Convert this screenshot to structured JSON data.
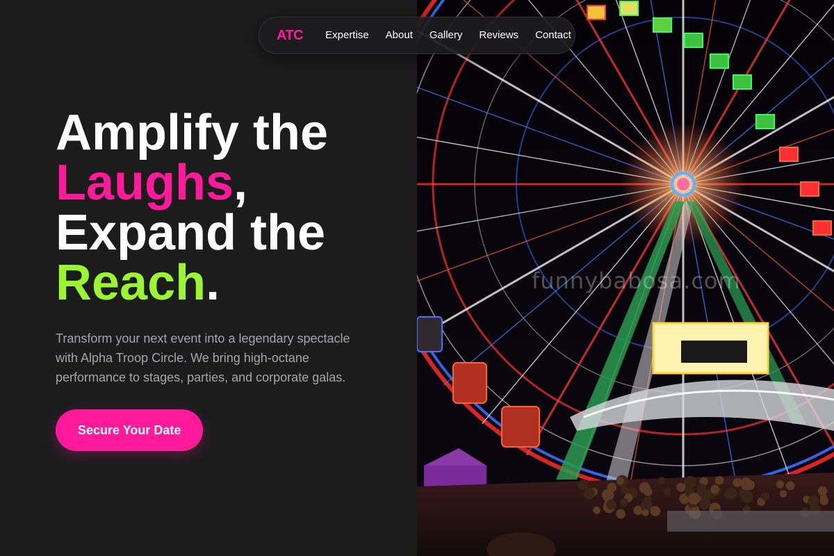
{
  "nav": {
    "logo": "ATC",
    "links": [
      "Expertise",
      "About",
      "Gallery",
      "Reviews",
      "Contact"
    ]
  },
  "hero": {
    "line1": "Amplify the",
    "line2_highlight": "Laughs",
    "line2_punct": ",",
    "line3": "Expand the",
    "line4_highlight": "Reach",
    "line4_punct": ".",
    "description": "Transform your next event into a legendary spectacle with Alpha Troop Circle. We bring high-octane performance to stages, parties, and corporate galas.",
    "cta_label": "Secure Your Date"
  },
  "image": {
    "watermark": "funnybabosa.com"
  },
  "colors": {
    "background": "#1c1c1d",
    "accent_pink": "#ff1a9c",
    "accent_green": "#9cf531",
    "text_primary": "#ffffff",
    "text_muted": "#a4a4aa"
  }
}
